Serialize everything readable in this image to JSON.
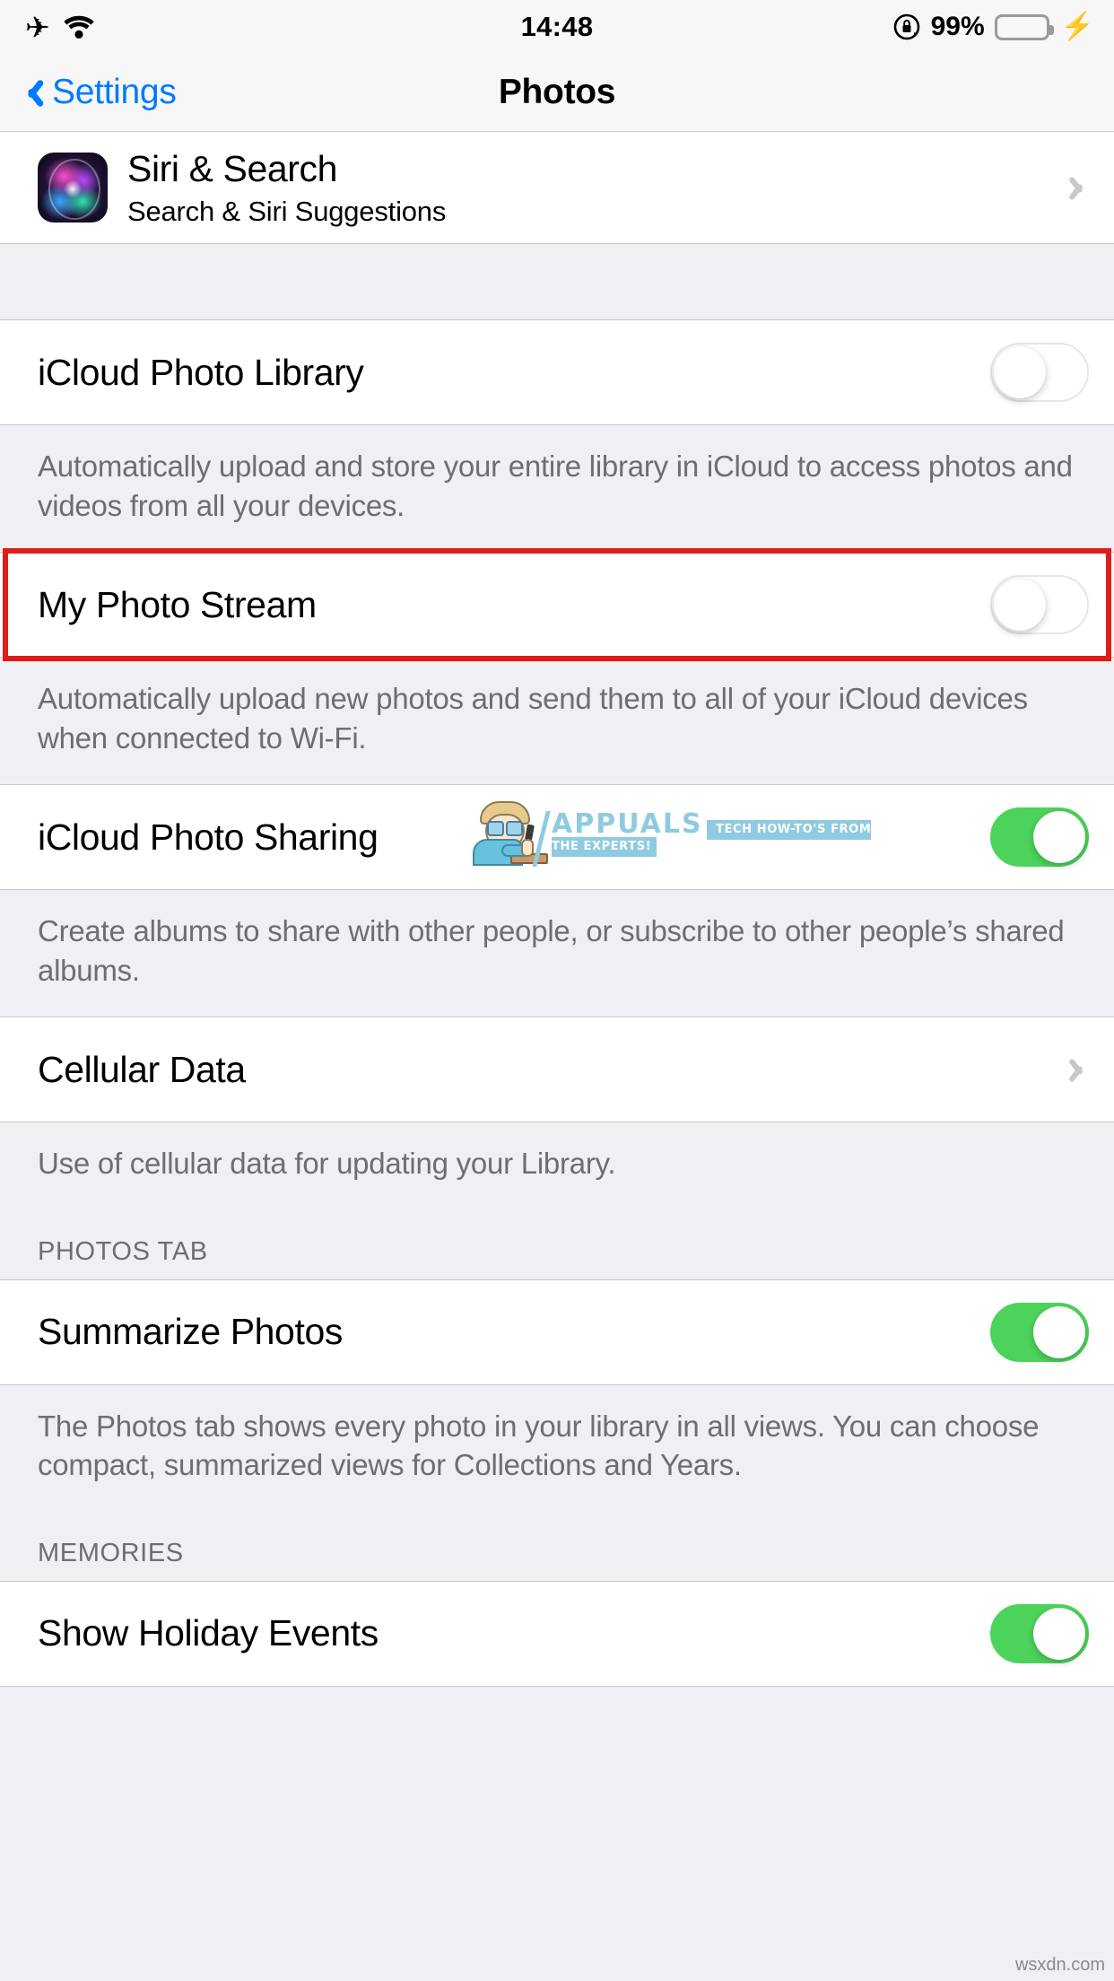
{
  "status_bar": {
    "airplane_icon": "airplane-mode-icon",
    "wifi_icon": "wifi-icon",
    "time": "14:48",
    "rotation_lock_icon": "rotation-lock-icon",
    "battery_percent": "99%",
    "battery_icon": "battery-icon",
    "charging_icon": "lightning-bolt-icon",
    "battery_color": "#4CD964"
  },
  "nav": {
    "back_label": "Settings",
    "back_icon": "chevron-left-icon",
    "title": "Photos",
    "tint_color": "#007AFF"
  },
  "sections": {
    "siri": {
      "icon": "siri-app-icon",
      "title": "Siri & Search",
      "subtitle": "Search & Siri Suggestions",
      "disclosure_icon": "chevron-right-icon"
    },
    "icloud_photo_library": {
      "label": "iCloud Photo Library",
      "toggle_state": "off",
      "footer": "Automatically upload and store your entire library in iCloud to access photos and videos from all your devices."
    },
    "my_photo_stream": {
      "label": "My Photo Stream",
      "toggle_state": "off",
      "footer": "Automatically upload new photos and send them to all of your iCloud devices when connected to Wi-Fi.",
      "highlighted": true,
      "highlight_color": "#E01B1B"
    },
    "icloud_photo_sharing": {
      "label": "iCloud Photo Sharing",
      "toggle_state": "on",
      "footer": "Create albums to share with other people, or subscribe to other people’s shared albums."
    },
    "cellular_data": {
      "label": "Cellular Data",
      "disclosure_icon": "chevron-right-icon",
      "footer": "Use of cellular data for updating your Library."
    },
    "photos_tab": {
      "header": "PHOTOS TAB",
      "summarize_photos": {
        "label": "Summarize Photos",
        "toggle_state": "on"
      },
      "footer": "The Photos tab shows every photo in your library in all views. You can choose compact, summarized views for Collections and Years."
    },
    "memories": {
      "header": "MEMORIES",
      "show_holiday_events": {
        "label": "Show Holiday Events",
        "toggle_state": "on"
      }
    }
  },
  "watermarks": {
    "appuals_name": "APPUALS",
    "appuals_tagline": "TECH HOW-TO'S FROM\nTHE EXPERTS!",
    "appuals_color": "#8FCBE0",
    "site": "wsxdn.com"
  },
  "toggle_colors": {
    "on": "#4CD35A",
    "off_track": "#FFFFFF",
    "knob": "#FFFFFF"
  }
}
